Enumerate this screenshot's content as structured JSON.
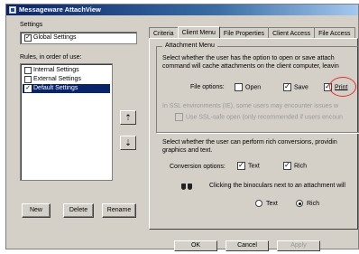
{
  "window": {
    "title": "Messageware AttachView"
  },
  "settings_panel": {
    "group_label": "Settings",
    "global_item": {
      "label": "Global Settings",
      "checked": true
    },
    "rules_label": "Rules, in order of use:",
    "rules": [
      {
        "label": "Internal Settings",
        "checked": false,
        "selected": false
      },
      {
        "label": "External Settings",
        "checked": false,
        "selected": false
      },
      {
        "label": "Default Settings",
        "checked": true,
        "selected": true
      }
    ],
    "move_up_icon": "arrow-up-icon",
    "move_down_icon": "arrow-down-icon",
    "buttons": {
      "new": "New",
      "delete": "Delete",
      "rename": "Rename"
    }
  },
  "tabs": [
    {
      "label": "Criteria",
      "active": false
    },
    {
      "label": "Client Menu",
      "active": true
    },
    {
      "label": "File Properties",
      "active": false
    },
    {
      "label": "Client Access",
      "active": false
    },
    {
      "label": "File Access",
      "active": false
    }
  ],
  "attachment_menu": {
    "legend": "Attachment Menu",
    "description_line1": "Select whether the user has the option to open or save attach",
    "description_line2": "command will cache attachments on the client computer, leavin",
    "file_options_label": "File options:",
    "open": {
      "label": "Open",
      "checked": false
    },
    "save": {
      "label": "Save",
      "checked": true
    },
    "print": {
      "label": "Print",
      "checked": true
    },
    "ssl_line": "In SSL environments (IE), some users may encounter issues w",
    "ssl_option": {
      "label": "Use SSL-safe open (only recommended if users encoun",
      "checked": false
    }
  },
  "conversion": {
    "description_line1": "Select whether the user can perform rich conversions, providin",
    "description_line2": "graphics and text.",
    "options_label": "Conversion options:",
    "text": {
      "label": "Text",
      "checked": true
    },
    "rich": {
      "label": "Rich",
      "checked": true
    },
    "binoculars_icon": "binoculars-icon",
    "binoculars_text": "Clicking the binoculars next to an attachment will",
    "radio_text": {
      "label": "Text",
      "selected": false
    },
    "radio_rich": {
      "label": "Rich",
      "selected": true
    }
  },
  "dialog_buttons": {
    "ok": "OK",
    "cancel": "Cancel",
    "apply": "Apply"
  },
  "colors": {
    "highlight_circle": "#e0302a",
    "selection": "#0a246a",
    "title_bar": "#0a246a"
  }
}
